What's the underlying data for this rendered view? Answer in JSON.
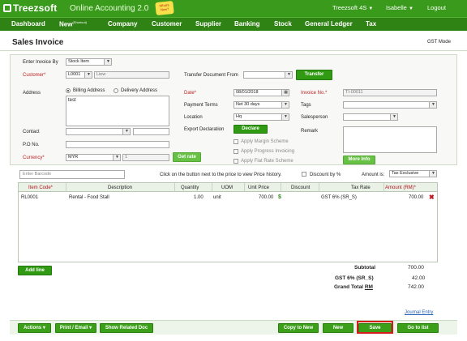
{
  "app": {
    "logo_text": "Treezsoft",
    "title": "Online Accounting 2.0",
    "badge_text": "What's New?",
    "company": "Treezsoft 4S",
    "user": "Isabelle",
    "logout": "Logout"
  },
  "nav": {
    "items": [
      "Dashboard",
      "New",
      "Company",
      "Customer",
      "Supplier",
      "Banking",
      "Stock",
      "General Ledger",
      "Tax"
    ],
    "new_shortcut": "(Shortcut)"
  },
  "page": {
    "title": "Sales Invoice",
    "gst_mode": "GST Mode"
  },
  "form": {
    "enter_by_label": "Enter Invoice By",
    "enter_by_value": "Stock Item",
    "customer_label": "Customer*",
    "customer_code": "L0001",
    "customer_name": "Liew",
    "transfer_label": "Transfer Document From",
    "transfer_btn": "Transfer",
    "address_label": "Address",
    "billing_label": "Billing Address",
    "delivery_label": "Delivery Address",
    "address_value": "test",
    "date_label": "Date*",
    "date_value": "08/01/2018",
    "invoice_no_label": "Invoice No.*",
    "invoice_no_value": "TI-00011",
    "payment_terms_label": "Payment Terms",
    "payment_terms_value": "Net 30 days",
    "tags_label": "Tags",
    "location_label": "Location",
    "location_value": "Hq",
    "salesperson_label": "Salesperson",
    "export_label": "Export Declaration",
    "declare_btn": "Declare",
    "remark_label": "Remark",
    "margin_label": "Apply Margin Scheme",
    "progress_label": "Apply Progress Invoicing",
    "flatrate_label": "Apply Flat Rate Scheme",
    "contact_label": "Contact",
    "po_label": "P.O No.",
    "currency_label": "Currency*",
    "currency_value": "MYR",
    "rate_value": "1",
    "get_rate_btn": "Get rate",
    "more_info_btn": "More Info"
  },
  "items_bar": {
    "barcode_placeholder": "Enter Barcode",
    "hint": "Click on the button next to the price to view Price history.",
    "discount_label": "Discount by %",
    "amount_is_label": "Amount is:",
    "amount_is_value": "Tax Exclusive"
  },
  "table": {
    "headers": [
      "Item Code*",
      "Description",
      "Quantity",
      "UOM",
      "Unit Price",
      "Discount",
      "Tax Rate",
      "Amount (RM)*"
    ],
    "rows": [
      {
        "item_code": "RL0001",
        "description": "Rental - Food Stall",
        "quantity": "1.00",
        "uom": "unit",
        "unit_price": "700.00",
        "discount": "",
        "tax_rate": "GST 6% (SR_S)",
        "amount": "700.00"
      }
    ]
  },
  "add_line": "Add line",
  "totals": {
    "subtotal_label": "Subtotal",
    "subtotal": "700.00",
    "gst_label": "GST 6% (SR_S)",
    "gst": "42.00",
    "grand_label": "Grand Total",
    "grand_currency": "RM",
    "grand": "742.00"
  },
  "journal_entry": "Journal Entry",
  "bottom": {
    "actions": "Actions",
    "print_email": "Print / Email",
    "related_doc": "Show Related Doc",
    "copy_new": "Copy to New",
    "new": "New",
    "save": "Save",
    "go_list": "Go to list"
  },
  "colors": {
    "brand_green": "#3a9a1c",
    "nav_green": "#2f8214",
    "required_red": "#b22222",
    "highlight_red": "#d61b1b"
  }
}
